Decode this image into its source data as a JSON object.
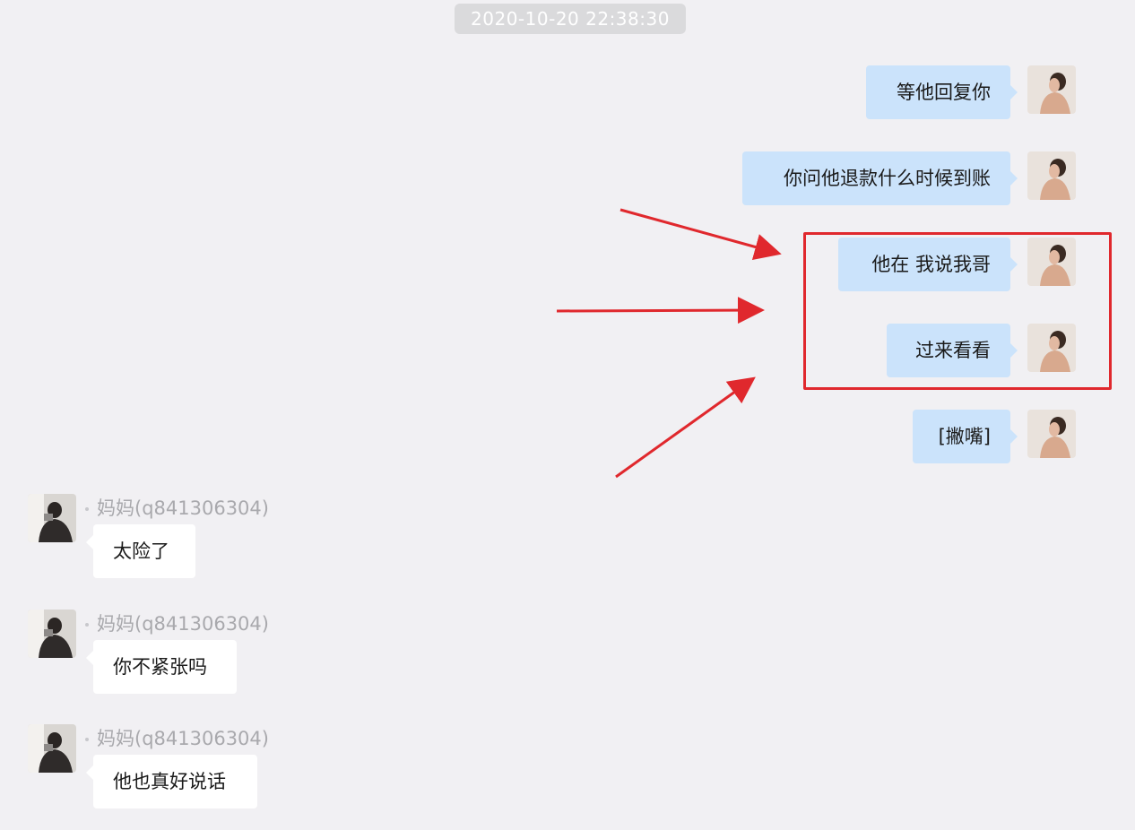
{
  "chat": {
    "timestamp": "2020-10-20 22:38:30",
    "outgoing": [
      {
        "text": "等他回复你"
      },
      {
        "text": "你问他退款什么时候到账"
      },
      {
        "text": "他在 我说我哥"
      },
      {
        "text": "过来看看"
      },
      {
        "text": "[撇嘴]"
      }
    ],
    "incoming": [
      {
        "sender": "妈妈(q841306304)",
        "text": "太险了"
      },
      {
        "sender": "妈妈(q841306304)",
        "text": "你不紧张吗"
      },
      {
        "sender": "妈妈(q841306304)",
        "text": "他也真好说话"
      }
    ]
  },
  "colors": {
    "background": "#f1f0f3",
    "outgoing_bubble": "#cbe3fb",
    "incoming_bubble": "#ffffff",
    "annotation_red": "#e0282d"
  },
  "icons": [
    "self-avatar-icon",
    "mom-avatar-icon",
    "red-arrow-icon"
  ]
}
